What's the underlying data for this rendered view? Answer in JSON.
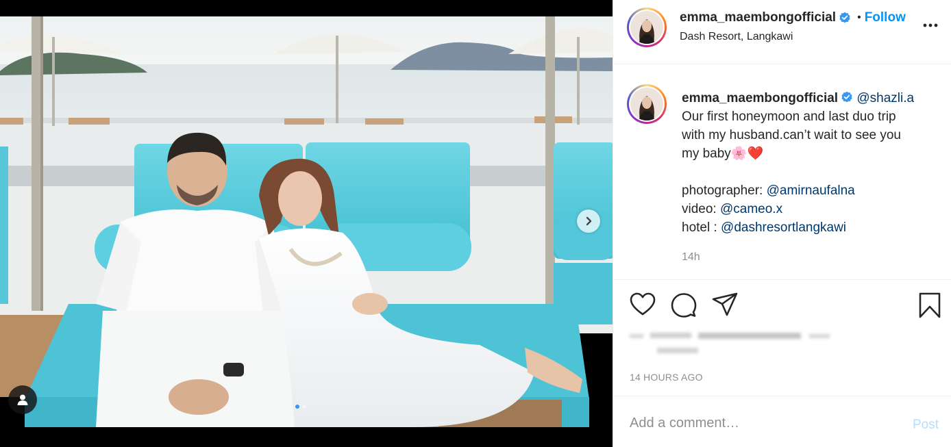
{
  "post": {
    "username": "emma_maembongofficial",
    "verified": true,
    "separator": "•",
    "follow_label": "Follow",
    "location": "Dash Resort, Langkawi",
    "more_icon": "more-horizontal-icon"
  },
  "media": {
    "slide_count": 2,
    "active_slide": 1,
    "next_icon": "chevron-right-icon",
    "tag_icon": "person-tag-icon"
  },
  "caption": {
    "username": "emma_maembongofficial",
    "mention_tag": "@shazli.a",
    "line1": "Our first honeymoon and last duo trip",
    "line2": "with my husband.can’t wait to see you",
    "line3": "my baby",
    "emoji": "🌸❤️",
    "photographer_label": "photographer:",
    "photographer": "@amirnaufalna",
    "video_label": "video:",
    "video": "@cameo.x",
    "hotel_label": "hotel :",
    "hotel": "@dashresortlangkawi",
    "time": "14h"
  },
  "actions": {
    "like_icon": "heart-icon",
    "comment_icon": "comment-icon",
    "share_icon": "share-icon",
    "save_icon": "bookmark-icon"
  },
  "posted_ago": "14 HOURS AGO",
  "comment": {
    "placeholder": "Add a comment…",
    "post_label": "Post"
  },
  "colors": {
    "accent": "#0095f6",
    "mention": "#00376b",
    "muted": "#8e8e8e",
    "post_disabled": "#b2dffc",
    "pool_cushion": "#5ccfe0"
  }
}
